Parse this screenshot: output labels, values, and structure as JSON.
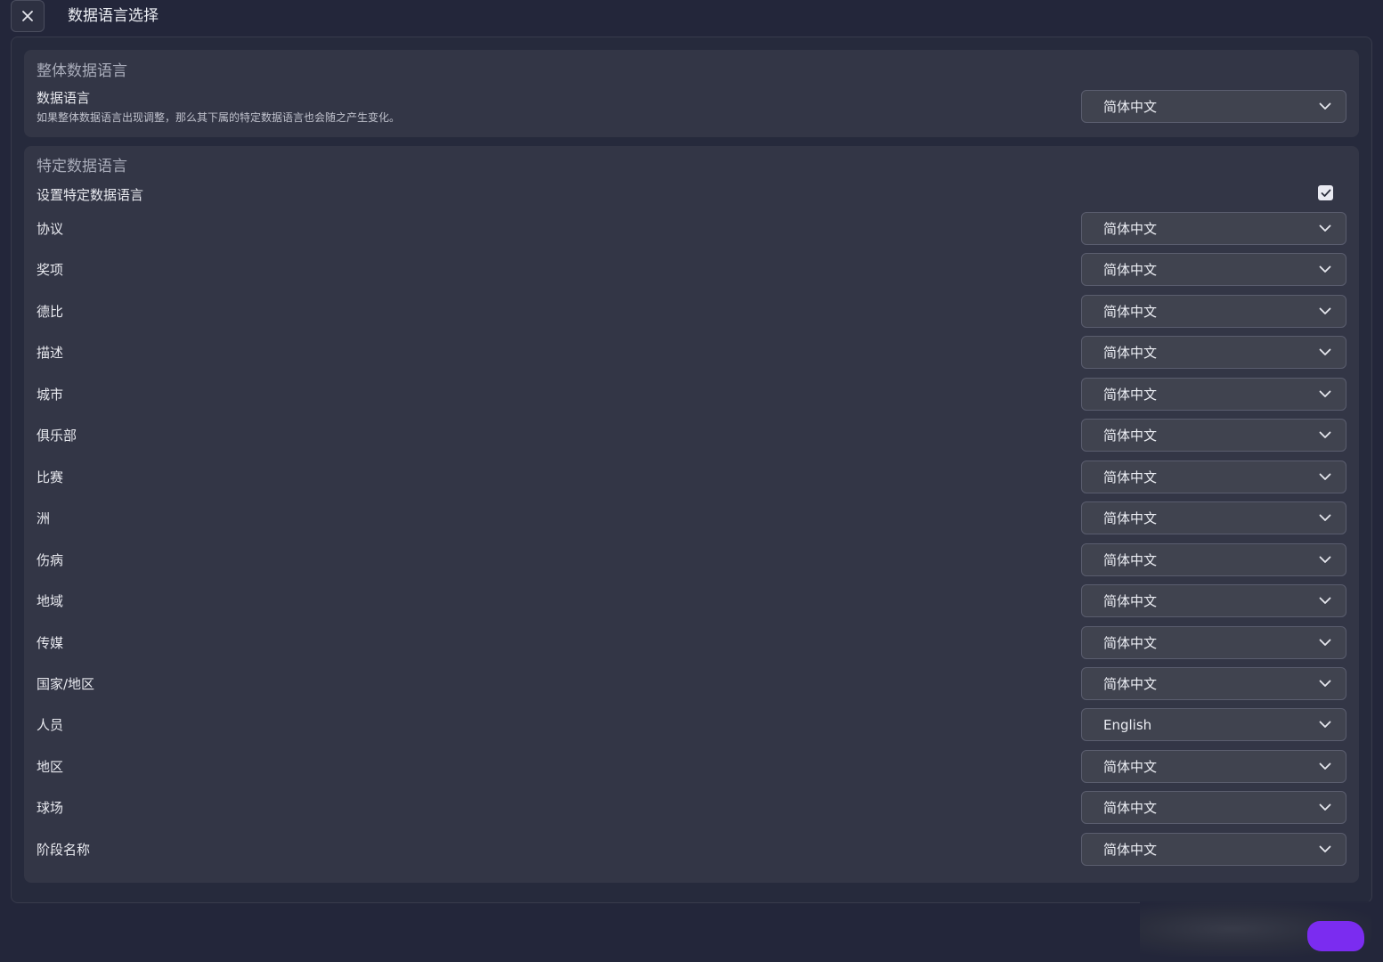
{
  "window": {
    "title": "数据语言选择",
    "close_icon": "close-icon"
  },
  "global_section": {
    "title": "整体数据语言",
    "field_label": "数据语言",
    "field_description": "如果整体数据语言出现调整，那么其下属的特定数据语言也会随之产生变化。",
    "selected": "简体中文"
  },
  "specific_section": {
    "title": "特定数据语言",
    "toggle_label": "设置特定数据语言",
    "toggle_checked": true,
    "rows": [
      {
        "label": "协议",
        "selected": "简体中文"
      },
      {
        "label": "奖项",
        "selected": "简体中文"
      },
      {
        "label": "德比",
        "selected": "简体中文"
      },
      {
        "label": "描述",
        "selected": "简体中文"
      },
      {
        "label": "城市",
        "selected": "简体中文"
      },
      {
        "label": "俱乐部",
        "selected": "简体中文"
      },
      {
        "label": "比赛",
        "selected": "简体中文"
      },
      {
        "label": "洲",
        "selected": "简体中文"
      },
      {
        "label": "伤病",
        "selected": "简体中文"
      },
      {
        "label": "地域",
        "selected": "简体中文"
      },
      {
        "label": "传媒",
        "selected": "简体中文"
      },
      {
        "label": "国家/地区",
        "selected": "简体中文"
      },
      {
        "label": "人员",
        "selected": "English"
      },
      {
        "label": "地区",
        "selected": "简体中文"
      },
      {
        "label": "球场",
        "selected": "简体中文"
      },
      {
        "label": "阶段名称",
        "selected": "简体中文"
      }
    ]
  },
  "colors": {
    "background": "#23263a",
    "card": "#333646",
    "select_bg": "#40434f",
    "accent_blob": "#7b2cf0"
  }
}
